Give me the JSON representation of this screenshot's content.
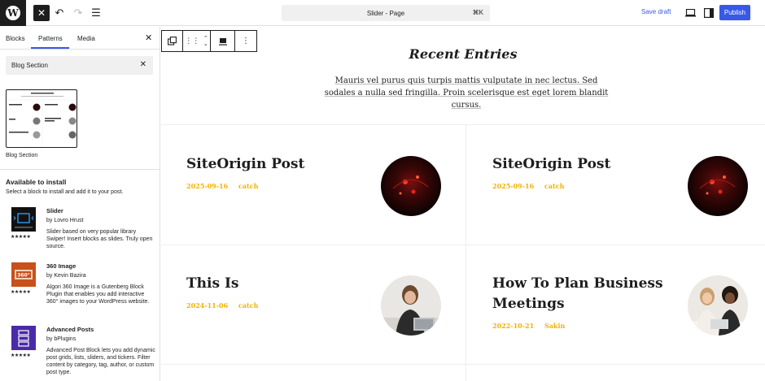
{
  "topbar": {
    "document_title": "Slider - Page",
    "shortcut": "⌘K",
    "save_draft": "Save draft",
    "publish": "Publish"
  },
  "sidebar": {
    "tabs": [
      "Blocks",
      "Patterns",
      "Media"
    ],
    "search_value": "Blog Section",
    "pattern_label": "Blog Section",
    "available_title": "Available to install",
    "available_sub": "Select a block to install and add it to your post.",
    "plugins": [
      {
        "name": "Slider",
        "author": "by Lovro Hrust",
        "desc": "Slider based on very popular library Swiper! Insert blocks as slides. Truly open source.",
        "stars": "★★★★★",
        "icon": "slider-plugin-icon",
        "color": "#111111"
      },
      {
        "name": "360 Image",
        "author": "by Kevin Bazira",
        "desc": "Algori 360 Image is a Gutenberg Block Plugin that enables you add interactive 360° images to your WordPress website.",
        "stars": "★★★★★",
        "icon": "image-360-plugin-icon",
        "color": "#c8501a"
      },
      {
        "name": "Advanced Posts",
        "author": "by bPlugins",
        "desc": "Advanced Post Block lets you add dynamic post grids, lists, sliders, and tickers. Filter content by category, tag, author, or custom post type.",
        "stars": "★★★★★",
        "icon": "advanced-posts-plugin-icon",
        "color": "#4a2aa8"
      }
    ]
  },
  "canvas": {
    "heading": "Recent Entries",
    "intro": "Mauris vel purus quis turpis mattis vulputate in nec lectus. Sed sodales a nulla sed fringilla. Proin scelerisque est eget lorem blandit cursus.",
    "posts": [
      {
        "title": "SiteOrigin Post",
        "date": "2025-09-16",
        "author": "catch",
        "image": "dark-red-circle-image"
      },
      {
        "title": "SiteOrigin Post",
        "date": "2025-09-16",
        "author": "catch",
        "image": "dark-red-circle-image"
      },
      {
        "title": "This Is",
        "date": "2024-11-06",
        "author": "catch",
        "image": "woman-at-laptop-image"
      },
      {
        "title": "How To Plan Business Meetings",
        "date": "2022-10-21",
        "author": "Sakin",
        "image": "two-women-laptop-image"
      }
    ]
  },
  "colors": {
    "accent": "#3858e9",
    "meta_yellow": "#f0b400",
    "dark": "#1e1e1e"
  }
}
